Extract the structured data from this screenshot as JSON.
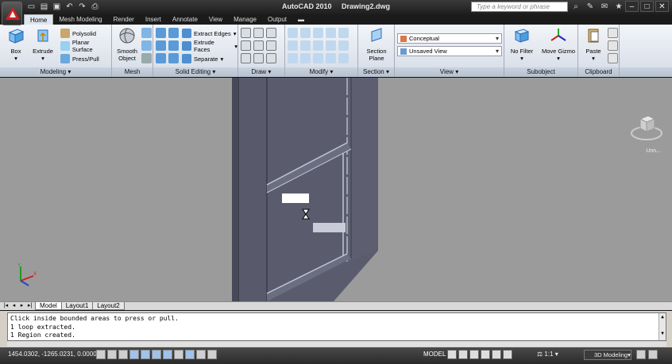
{
  "title": {
    "app": "AutoCAD 2010",
    "file": "Drawing2.dwg",
    "search_placeholder": "Type a keyword or phrase"
  },
  "tabs": [
    "Home",
    "Mesh Modeling",
    "Render",
    "Insert",
    "Annotate",
    "View",
    "Manage",
    "Output"
  ],
  "ribbon": {
    "modeling": {
      "title": "Modeling",
      "box": "Box",
      "extrude": "Extrude",
      "polysolid": "Polysolid",
      "planar_surface": "Planar Surface",
      "press_pull": "Press/Pull"
    },
    "mesh": {
      "title": "Mesh",
      "smooth": "Smooth",
      "object": "Object"
    },
    "solid_editing": {
      "title": "Solid Editing",
      "extract_edges": "Extract Edges",
      "extrude_faces": "Extrude Faces",
      "separate": "Separate"
    },
    "draw": {
      "title": "Draw"
    },
    "modify": {
      "title": "Modify"
    },
    "section": {
      "title": "Section",
      "section": "Section",
      "plane": "Plane"
    },
    "view": {
      "title": "View",
      "visual_style": "Conceptual",
      "named_view": "Unsaved View"
    },
    "subobject": {
      "title": "Subobject",
      "no_filter": "No Filter",
      "move_gizmo": "Move Gizmo"
    },
    "clipboard": {
      "title": "Clipboard",
      "paste": "Paste"
    }
  },
  "viewport": {
    "viewcube_label": "Unn..."
  },
  "layout_tabs": [
    "Model",
    "Layout1",
    "Layout2"
  ],
  "command_history": [
    "Click inside bounded areas to press or pull.",
    "1 loop extracted.",
    "1 Region created."
  ],
  "status": {
    "coordinates": "1454.0302, -1265.0231, 0.0000",
    "space": "MODEL",
    "annotation_scale": "1:1",
    "workspace": "3D Modeling"
  },
  "colors": {
    "viewport_bg": "#9b9b9b",
    "solid_face": "#5a5c6e",
    "solid_edge": "#b5b8c6",
    "ribbon_bg": "#e6ebf2"
  }
}
